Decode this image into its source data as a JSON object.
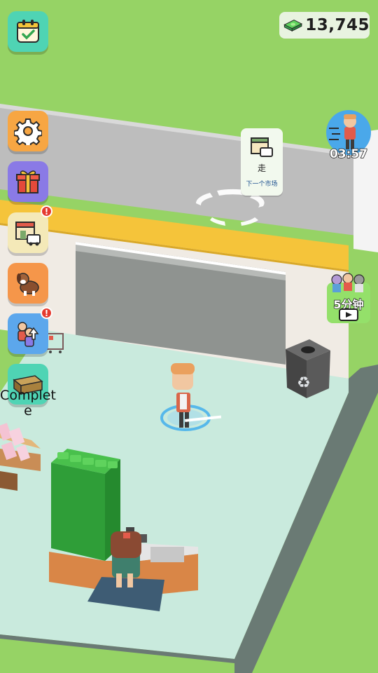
{
  "hud": {
    "money": "13,745",
    "complete_label": "Complete",
    "timer": "03:57",
    "next_market": {
      "go_label": "走",
      "sub_label": "下一个市场"
    },
    "ad_label": "5分钟",
    "badge_mark": "!"
  },
  "icons": {
    "calendar": "calendar-check-icon",
    "settings": "gear-icon",
    "gift": "gift-icon",
    "shop": "shop-delivery-icon",
    "dog": "dog-icon",
    "upgrade": "staff-upgrade-icon",
    "complete": "bread-crate-icon",
    "money": "cash-stack-icon",
    "recycle": "recycle-icon",
    "play": "play-video-icon"
  },
  "colors": {
    "grass": "#96d365",
    "floor": "#c9eadd",
    "awning": "#f5c43a",
    "money_green": "#3bb14a",
    "badge_red": "#e53a2f"
  }
}
